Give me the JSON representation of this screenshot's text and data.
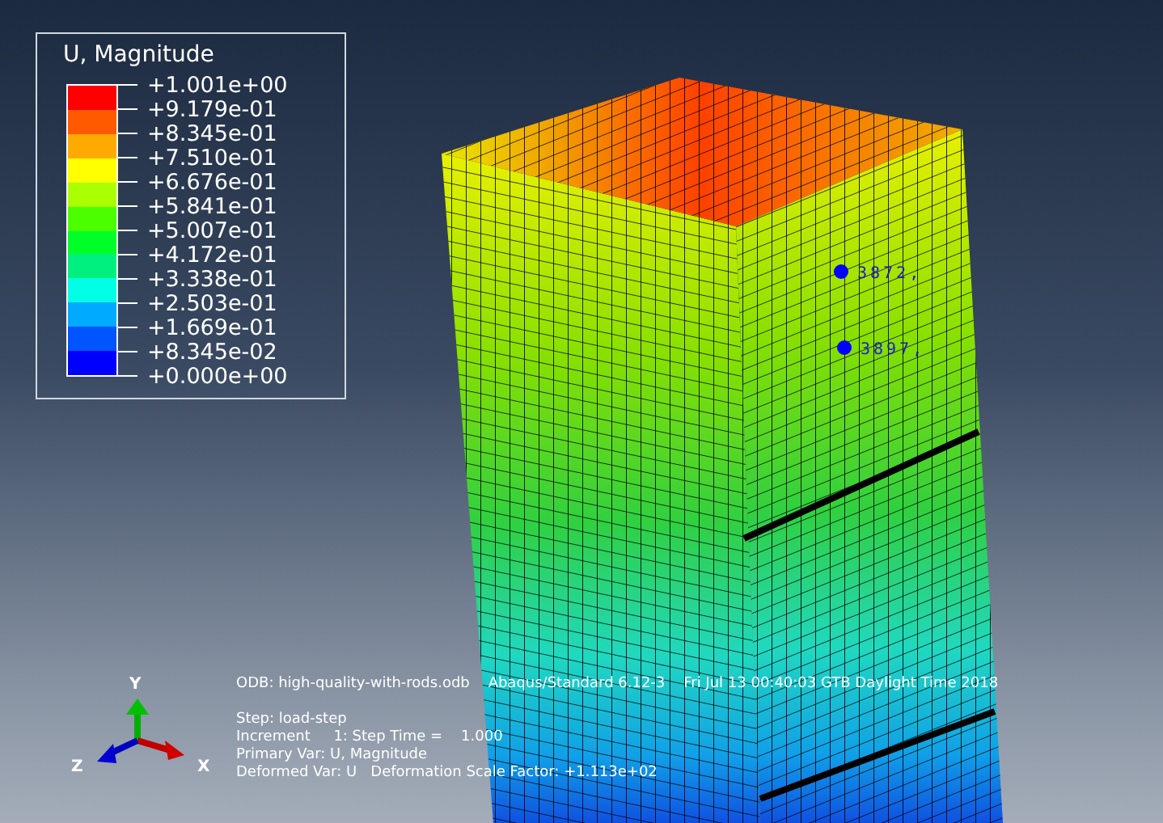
{
  "legend": {
    "title": "U, Magnitude",
    "values": [
      "+1.001e+00",
      "+9.179e-01",
      "+8.345e-01",
      "+7.510e-01",
      "+6.676e-01",
      "+5.841e-01",
      "+5.007e-01",
      "+4.172e-01",
      "+3.338e-01",
      "+2.503e-01",
      "+1.669e-01",
      "+8.345e-02",
      "+0.000e+00"
    ],
    "bands": [
      {
        "color": "#ff0000"
      },
      {
        "color": "#ff5a00"
      },
      {
        "color": "#ffaa00"
      },
      {
        "color": "#ffff00"
      },
      {
        "color": "#aaff00"
      },
      {
        "color": "#4cff00"
      },
      {
        "color": "#00ff28"
      },
      {
        "color": "#00f080"
      },
      {
        "color": "#00ffe6"
      },
      {
        "color": "#00aaff"
      },
      {
        "color": "#0055ff"
      },
      {
        "color": "#0000ff"
      }
    ]
  },
  "nodes": [
    {
      "label": "3872,"
    },
    {
      "label": "3897,"
    }
  ],
  "info": {
    "odb": "ODB: high-quality-with-rods.odb    Abaqus/Standard 6.12-3    Fri Jul 13 00:40:03 GTB Daylight Time 2018",
    "lines": [
      "Step: load-step",
      "Increment     1: Step Time =    1.000",
      "Primary Var: U, Magnitude",
      "Deformed Var: U   Deformation Scale Factor: +1.113e+02"
    ]
  },
  "triad": {
    "x": "X",
    "y": "Y",
    "z": "Z"
  }
}
